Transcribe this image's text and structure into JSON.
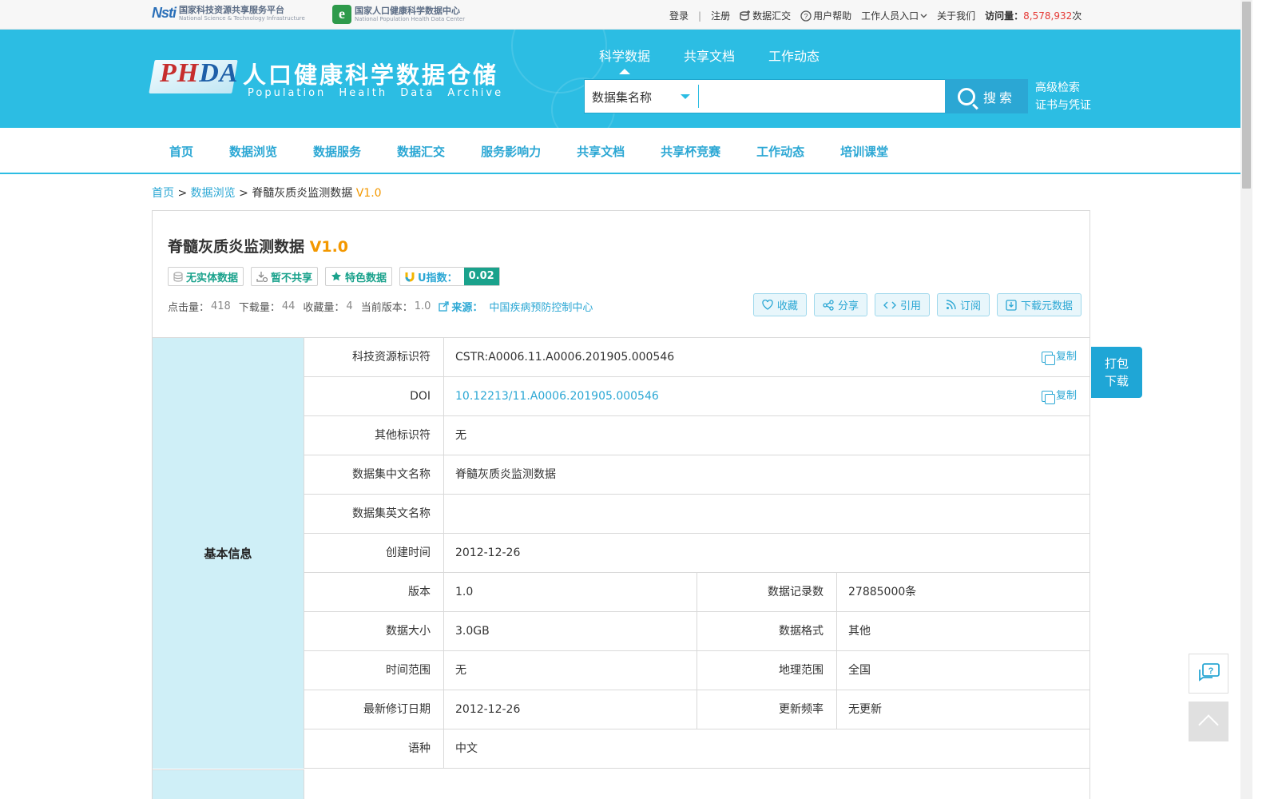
{
  "topbar": {
    "logo1_mark": "Nsti",
    "logo1_cn": "国家科技资源共享服务平台",
    "logo1_en": "National Science & Technology Infrastructure",
    "logo2_mark": "e",
    "logo2_cn": "国家人口健康科学数据中心",
    "logo2_en": "National Population Health Data Center",
    "links": {
      "login": "登录",
      "sep": "|",
      "register": "注册",
      "data_submit": "数据汇交",
      "help": "用户帮助",
      "staff": "工作人员入口",
      "about": "关于我们"
    },
    "visit_label": "访问量：",
    "visit_count": "8,578,932",
    "visit_unit": "次"
  },
  "header": {
    "logo_mark_red": "PH",
    "logo_mark_blue": "DA",
    "title_cn": "人口健康科学数据仓储",
    "title_en": "Population Health Data Archive",
    "tabs": [
      "科学数据",
      "共享文档",
      "工作动态"
    ],
    "search": {
      "scope": "数据集名称",
      "value": "",
      "button": "搜索"
    },
    "advanced_search": "高级检索",
    "certificate": "证书与凭证"
  },
  "nav": [
    "首页",
    "数据浏览",
    "数据服务",
    "数据汇交",
    "服务影响力",
    "共享文档",
    "共享杯竞赛",
    "工作动态",
    "培训课堂"
  ],
  "breadcrumb": {
    "home": "首页",
    "sep": ">",
    "browse": "数据浏览",
    "current": "脊髓灰质炎监测数据",
    "version": "V1.0"
  },
  "dataset": {
    "title": "脊髓灰质炎监测数据",
    "version": "V1.0",
    "tags": {
      "no_entity": "无实体数据",
      "not_shared": "暂不共享",
      "featured": "特色数据",
      "u_index_label": "U指数：",
      "u_index_value": "0.02"
    },
    "stats": {
      "clicks_label": "点击量：",
      "clicks": "418",
      "downloads_label": "下载量：",
      "downloads": "44",
      "favorites_label": "收藏量：",
      "favorites": "4",
      "version_label": "当前版本：",
      "version": "1.0",
      "source_label": "来源：",
      "source": "中国疾病预防控制中心"
    },
    "actions": {
      "favorite": "收藏",
      "share": "分享",
      "cite": "引用",
      "subscribe": "订阅",
      "download_meta": "下载元数据"
    }
  },
  "info": {
    "section": "基本信息",
    "copy_label": "复制",
    "rows": {
      "cstr_k": "科技资源标识符",
      "cstr_v": "CSTR:A0006.11.A0006.201905.000546",
      "doi_k": "DOI",
      "doi_v": "10.12213/11.A0006.201905.000546",
      "other_k": "其他标识符",
      "other_v": "无",
      "name_cn_k": "数据集中文名称",
      "name_cn_v": "脊髓灰质炎监测数据",
      "name_en_k": "数据集英文名称",
      "name_en_v": "",
      "created_k": "创建时间",
      "created_v": "2012-12-26",
      "version_k": "版本",
      "version_v": "1.0",
      "records_k": "数据记录数",
      "records_v": "27885000条",
      "size_k": "数据大小",
      "size_v": "3.0GB",
      "format_k": "数据格式",
      "format_v": "其他",
      "time_k": "时间范围",
      "time_v": "无",
      "geo_k": "地理范围",
      "geo_v": "全国",
      "revised_k": "最新修订日期",
      "revised_v": "2012-12-26",
      "freq_k": "更新频率",
      "freq_v": "无更新",
      "lang_k": "语种",
      "lang_v": "中文"
    }
  },
  "float": {
    "pack_line1": "打包",
    "pack_line2": "下载"
  },
  "colors": {
    "primary": "#2cbde3",
    "link": "#2ba7d4",
    "accent": "#f39800",
    "green": "#1aa28c"
  }
}
